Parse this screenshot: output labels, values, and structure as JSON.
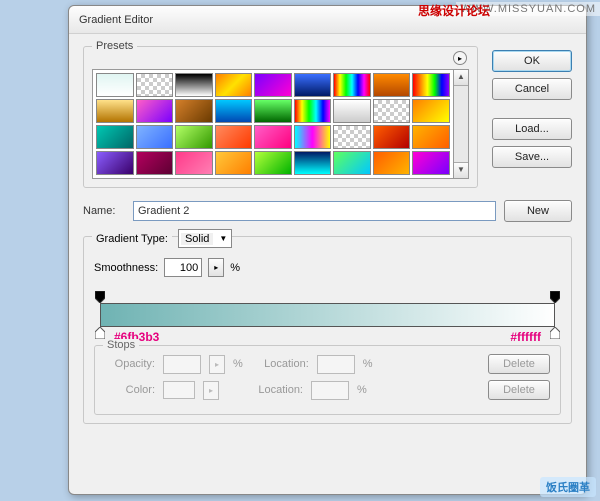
{
  "title": "Gradient Editor",
  "presets_label": "Presets",
  "buttons": {
    "ok": "OK",
    "cancel": "Cancel",
    "load": "Load...",
    "save": "Save...",
    "new": "New",
    "delete": "Delete"
  },
  "name_label": "Name:",
  "name_value": "Gradient 2",
  "gradient_type_label": "Gradient Type:",
  "gradient_type_value": "Solid",
  "smoothness_label": "Smoothness:",
  "smoothness_value": "100",
  "percent": "%",
  "stops_label": "Stops",
  "opacity_label": "Opacity:",
  "color_label": "Color:",
  "location_label": "Location:",
  "hex_left": "#6fb3b3",
  "hex_right": "#ffffff",
  "gradient_stops": {
    "left_color": "#6fb3b3",
    "right_color": "#ffffff",
    "left_opacity": 100,
    "right_opacity": 100
  },
  "swatches": [
    "linear-gradient(#e0f5f2,#ffffff)",
    "checker",
    "linear-gradient(#000,#fff)",
    "linear-gradient(135deg,#ff7f00,#ffe100,#ff7f00)",
    "linear-gradient(135deg,#7a00ff,#ff00d4)",
    "linear-gradient(#3a6fff,#001a66)",
    "linear-gradient(90deg,#ff0000,#ffff00,#00ff00,#00ffff,#0000ff,#ff00ff,#ff0000)",
    "linear-gradient(#ff8a00,#b34700)",
    "linear-gradient(90deg,#ff0000,#ff7f00,#ffff00,#00ff00,#0000ff,#8b00ff)",
    "linear-gradient(#ffe28a,#b37400)",
    "linear-gradient(135deg,#ff5ec7,#7a00ff)",
    "linear-gradient(135deg,#d47f2a,#6a3a00)",
    "linear-gradient(#00c8ff,#0047b3)",
    "linear-gradient(#66ff66,#006600)",
    "linear-gradient(90deg,#ff0000,#ffff00,#00ff00,#00ffff,#0000ff,#ff00ff)",
    "linear-gradient(#ffffff,#cccccc)",
    "checker",
    "linear-gradient(135deg,#ff7f00,#ffff00)",
    "linear-gradient(135deg,#00c8b3,#006666)",
    "linear-gradient(135deg,#7fb3ff,#3a6fff)",
    "linear-gradient(135deg,#b3ff66,#339900)",
    "linear-gradient(135deg,#ff8a5e,#ff3a00)",
    "linear-gradient(135deg,#ff5ec7,#ff007f)",
    "linear-gradient(90deg,#00ffff,#ff00ff,#ffff00)",
    "checker",
    "linear-gradient(135deg,#ff5e00,#b30000)",
    "linear-gradient(135deg,#ffb300,#ff5e00)",
    "linear-gradient(135deg,#8a5eff,#3a006a)",
    "linear-gradient(135deg,#b3005e,#5e0033)",
    "linear-gradient(135deg,#ff3a8a,#ff7fb3)",
    "linear-gradient(135deg,#ffc83a,#ff7f00)",
    "linear-gradient(135deg,#b3ff3a,#00b300)",
    "linear-gradient(#001a66,#00ffff)",
    "linear-gradient(135deg,#5eff5e,#00c8ff)",
    "linear-gradient(135deg,#ff5e00,#ffb300)",
    "linear-gradient(135deg,#ff00d4,#7a00ff)"
  ],
  "watermarks": {
    "top_right": "WWW.MISSYUAN.COM",
    "top_cn": "思缘设计论坛",
    "bottom": "饭氏圈革"
  }
}
